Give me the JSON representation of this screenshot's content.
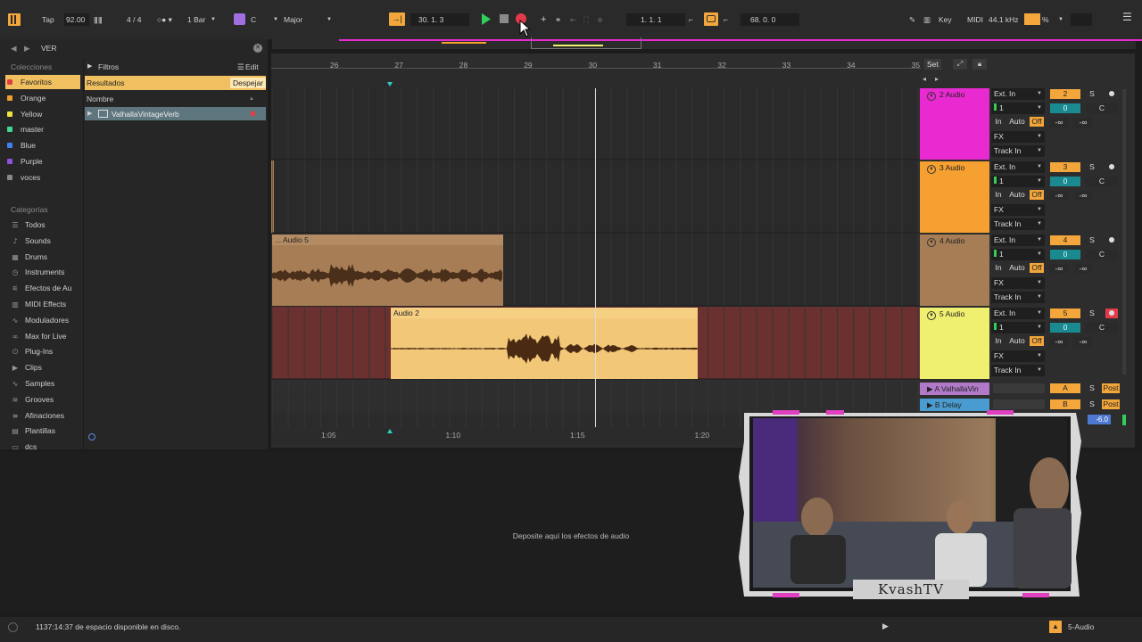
{
  "transport": {
    "tap": "Tap",
    "tempo": "92.00",
    "meter": "4 / 4",
    "quant": "1 Bar",
    "key": "C",
    "scale": "Major",
    "arrangement_pos": "30.  1.  3",
    "loop_start": "1.  1.  1",
    "loop_len": "68.  0.  0",
    "key_label": "Key",
    "midi_label": "MIDI",
    "sample_rate": "44.1 kHz",
    "cpu": "%"
  },
  "browser": {
    "search_value": "VER",
    "collections_heading": "Colecciones",
    "collections": [
      {
        "label": "Favoritos",
        "color": "#e04040"
      },
      {
        "label": "Orange",
        "color": "#f0a030"
      },
      {
        "label": "Yellow",
        "color": "#f0e040"
      },
      {
        "label": "master",
        "color": "#40d890"
      },
      {
        "label": "Blue",
        "color": "#4080f0"
      },
      {
        "label": "Purple",
        "color": "#9050e0"
      },
      {
        "label": "voces",
        "color": "#888888"
      }
    ],
    "categories_heading": "Categorías",
    "categories": [
      {
        "label": "Todos",
        "icon": "list-icon"
      },
      {
        "label": "Sounds",
        "icon": "sounds-icon"
      },
      {
        "label": "Drums",
        "icon": "drums-icon"
      },
      {
        "label": "Instruments",
        "icon": "instruments-icon"
      },
      {
        "label": "Efectos de Au",
        "icon": "audio-effects-icon"
      },
      {
        "label": "MIDI Effects",
        "icon": "midi-effects-icon"
      },
      {
        "label": "Moduladores",
        "icon": "modulators-icon"
      },
      {
        "label": "Max for Live",
        "icon": "max-icon"
      },
      {
        "label": "Plug-Ins",
        "icon": "plugins-icon"
      },
      {
        "label": "Clips",
        "icon": "clips-icon"
      },
      {
        "label": "Samples",
        "icon": "samples-icon"
      },
      {
        "label": "Grooves",
        "icon": "grooves-icon"
      },
      {
        "label": "Afinaciones",
        "icon": "tunings-icon"
      },
      {
        "label": "Plantillas",
        "icon": "templates-icon"
      },
      {
        "label": "dcs",
        "icon": "folder-icon"
      }
    ],
    "filters_label": "Filtros",
    "edit_label": "Edit",
    "results_label": "Resultados",
    "clear_label": "Despejar",
    "name_col": "Nombre",
    "result_item": "ValhallaVintageVerb"
  },
  "ruler": {
    "bars": [
      "26",
      "27",
      "28",
      "29",
      "30",
      "31",
      "32",
      "33",
      "34",
      "35"
    ],
    "times": [
      "1:05",
      "1:10",
      "1:15",
      "1:20"
    ],
    "set_label": "Set"
  },
  "clips": {
    "audio5_name": "... Audio 5",
    "audio2_name": "Audio 2"
  },
  "tracks": [
    {
      "name": "2 Audio",
      "color": "#e82ad0",
      "input": "Ext. In",
      "channel": "1",
      "number": "2",
      "vol": "0",
      "pan": "C"
    },
    {
      "name": "3 Audio",
      "color": "#f5a030",
      "input": "Ext. In",
      "channel": "1",
      "number": "3",
      "vol": "0",
      "pan": "C"
    },
    {
      "name": "4 Audio",
      "color": "#a67d55",
      "input": "Ext. In",
      "channel": "1",
      "number": "4",
      "vol": "0",
      "pan": "C"
    },
    {
      "name": "5 Audio",
      "color": "#f0f070",
      "input": "Ext. In",
      "channel": "1",
      "number": "5",
      "vol": "0",
      "pan": "C"
    }
  ],
  "mixer_labels": {
    "in": "In",
    "auto": "Auto",
    "off": "Off",
    "fx": "FX",
    "track_in": "Track In",
    "neg_inf": "-∞",
    "solo": "S"
  },
  "returns": [
    {
      "name": "A ValhallaVin",
      "letter": "A",
      "post": "Post",
      "color": "#b07ac8"
    },
    {
      "name": "B Delay",
      "letter": "B",
      "post": "Post",
      "color": "#4a9cd0"
    }
  ],
  "master_vol": "-6.0",
  "device_drop_text": "Deposite aquí los efectos de audio",
  "status_text": "1137:14:37 de espacio disponible en disco.",
  "status_track": "5-Audio",
  "webcam_caption": "KvashTV"
}
